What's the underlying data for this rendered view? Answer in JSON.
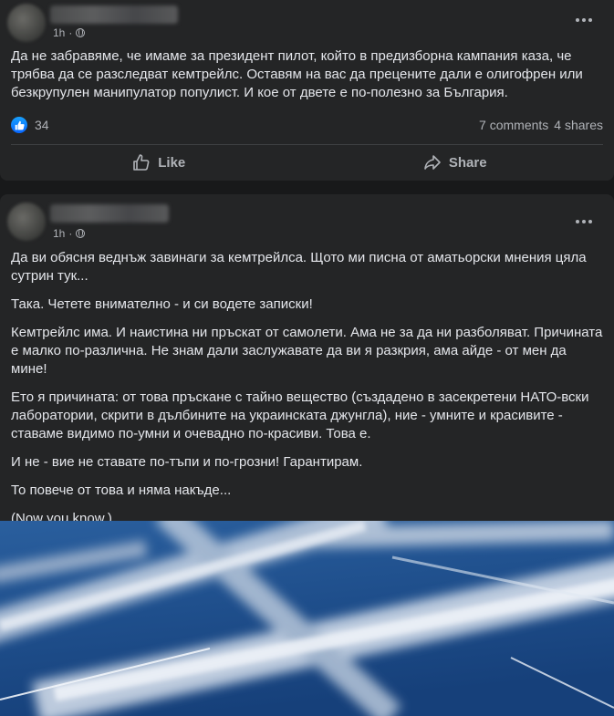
{
  "post1": {
    "time": "1h",
    "text": "Да не забравяме, че имаме за президент пилот, който в предизборна кампания каза, че трябва да се разследват кемтрейлс. Оставям на вас да прецените дали е олигофрен или безкрупулен манипулатор популист. И кое от двете е по-полезно за България.",
    "reaction_count": "34",
    "comments": "7 comments",
    "shares": "4 shares",
    "like_label": "Like",
    "share_label": "Share"
  },
  "post2": {
    "time": "1h",
    "paragraphs": [
      "Да ви обясня веднъж завинаги за кемтрейлса. Щото ми писна от аматьорски мнения цяла сутрин тук...",
      "Така. Четете внимателно - и си водете записки!",
      "Кемтрейлс има. И наистина ни пръскат от самолети. Ама не за да ни разболяват. Причината е малко по-различна. Не знам дали заслужавате да ви я разкрия, ама айде - от мен да мине!",
      "Ето я причината: от това пръскане с тайно вещество (създадено в засекретени НАТО-вски лаборатории, скрити в дълбините на украинската джунгла), ние - умните и красивите - ставаме видимо по-умни и очевадно по-красиви. Това е.",
      "И не - вие не ставате по-тъпи и по-грозни! Гарантирам.",
      "То повече от това и няма накъде...",
      "(Now you know.)"
    ]
  },
  "colors": {
    "background": "#18191a",
    "card": "#242526",
    "like_blue": "#0866ff"
  }
}
